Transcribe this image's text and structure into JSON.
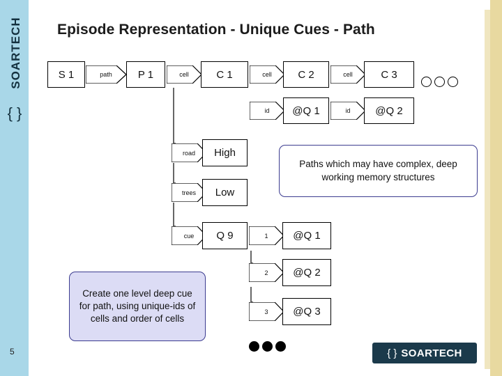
{
  "slide": {
    "title": "Episode Representation - Unique Cues - Path",
    "page_number": "5",
    "left_logo_text": "SOARTECH",
    "left_logo_bracket": "{ }",
    "bottom_logo_text": "SOARTECH",
    "bottom_logo_bracket": "{ }"
  },
  "row1": {
    "s1": "S 1",
    "arrow_path": "path",
    "p1": "P 1",
    "arrow_cell1": "cell",
    "c1": "C 1",
    "arrow_cell2": "cell",
    "c2": "C 2",
    "arrow_cell3": "cell",
    "c3": "C 3"
  },
  "row2": {
    "arrow_id1": "id",
    "q1": "@Q 1",
    "arrow_id2": "id",
    "q2": "@Q 2"
  },
  "branches": [
    {
      "arrow": "road",
      "box": "High"
    },
    {
      "arrow": "trees",
      "box": "Low"
    },
    {
      "arrow": "cue",
      "box": "Q 9"
    }
  ],
  "cue_chain": [
    {
      "arrow": "1",
      "box": "@Q 1"
    },
    {
      "arrow": "2",
      "box": "@Q 2"
    },
    {
      "arrow": "3",
      "box": "@Q 3"
    }
  ],
  "callouts": {
    "paths": "Paths which may have complex, deep working memory structures",
    "create": "Create one level deep cue for path, using unique-ids of cells and order of cells"
  },
  "ellipsis": {
    "top_right": "○ ○ ○",
    "bottom": "● ● ●"
  }
}
